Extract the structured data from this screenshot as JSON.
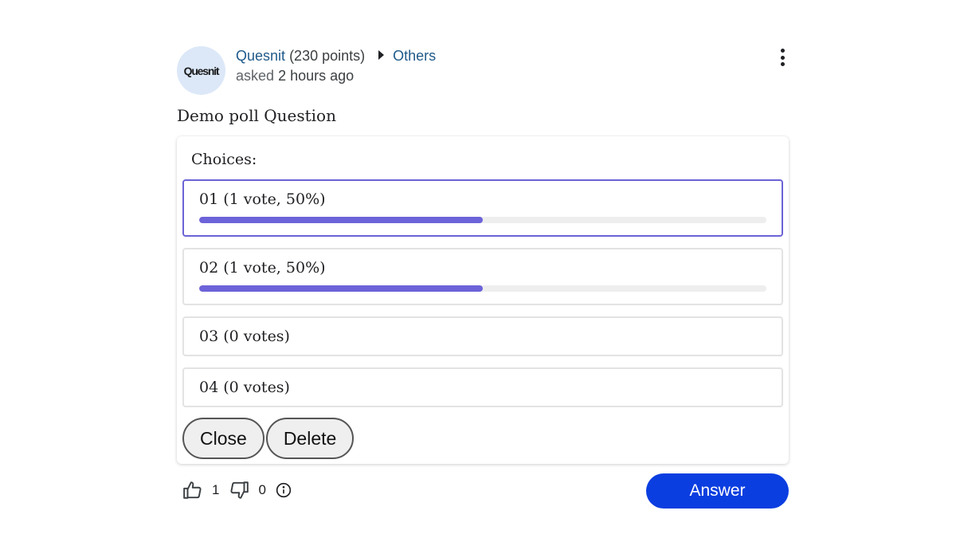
{
  "post": {
    "avatar_text": "Quesnit",
    "author": "Quesnit",
    "points": "(230 points)",
    "category": "Others",
    "asked_label": "asked",
    "asked_time": "2 hours ago",
    "question": "Demo poll Question"
  },
  "poll": {
    "choices_label": "Choices:",
    "choices": [
      {
        "label": "01 (1 vote, 50%)",
        "percent": 50,
        "selected": true
      },
      {
        "label": "02 (1 vote, 50%)",
        "percent": 50,
        "selected": false
      },
      {
        "label": "03 (0 votes)",
        "percent": 0,
        "selected": false
      },
      {
        "label": "04 (0 votes)",
        "percent": 0,
        "selected": false
      }
    ],
    "close_label": "Close",
    "delete_label": "Delete"
  },
  "footer": {
    "upvotes": "1",
    "downvotes": "0",
    "answer_label": "Answer"
  },
  "colors": {
    "link": "#1f5a8a",
    "accent": "#6c63d9",
    "answer_button": "#0b3ee0"
  },
  "icons": [
    "more-vertical-icon",
    "caret-right-icon",
    "thumbs-up-icon",
    "thumbs-down-icon",
    "info-icon"
  ]
}
